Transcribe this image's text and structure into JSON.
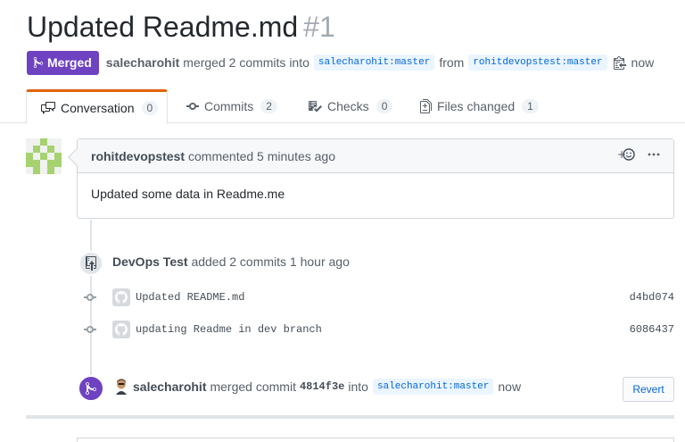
{
  "pr": {
    "title": "Updated Readme.md",
    "number": "#1",
    "status": "Merged",
    "author": "salecharohit",
    "merge_text": "merged 2 commits into",
    "base_branch": "salecharohit:master",
    "from_text": "from",
    "head_branch": "rohitdevopstest:master",
    "time": "now"
  },
  "tabs": [
    {
      "label": "Conversation",
      "count": "0",
      "icon": "comment-discussion-icon"
    },
    {
      "label": "Commits",
      "count": "2",
      "icon": "git-commit-icon"
    },
    {
      "label": "Checks",
      "count": "0",
      "icon": "checklist-icon"
    },
    {
      "label": "Files changed",
      "count": "1",
      "icon": "diff-icon"
    }
  ],
  "comment": {
    "author": "rohitdevopstest",
    "action": "commented 5 minutes ago",
    "body": "Updated some data in Readme.me",
    "icons": [
      "add-reaction-icon",
      "kebab-menu-icon"
    ]
  },
  "push_event": {
    "author": "DevOps Test",
    "text": "added 2 commits 1 hour ago",
    "icon": "repo-push-icon"
  },
  "commits": [
    {
      "message": "Updated README.md",
      "sha": "d4bd074"
    },
    {
      "message": "updating Readme in dev branch",
      "sha": "6086437"
    }
  ],
  "merge_event": {
    "author": "salecharohit",
    "text": "merged commit",
    "sha": "4814f3e",
    "into": "into",
    "branch": "salecharohit:master",
    "time": "now",
    "revert_label": "Revert"
  },
  "colors": {
    "merged": "#6f42c1",
    "link": "#0366d6",
    "tab_accent": "#e36209"
  }
}
